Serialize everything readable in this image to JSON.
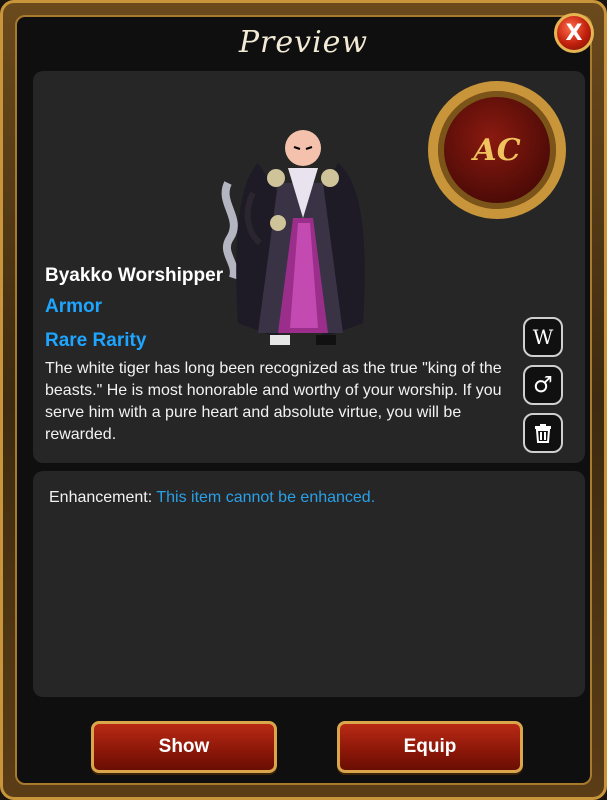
{
  "window": {
    "title": "Preview",
    "close_label": "X"
  },
  "item": {
    "name": "Byakko Worshipper",
    "type": "Armor",
    "rarity": "Rare Rarity",
    "description": "The white tiger has long been recognized as the true \"king of the beasts.\"  He is most honorable and worthy of your worship. If you serve him with a pure heart and absolute virtue, you will be rewarded."
  },
  "badge": {
    "text": "AC"
  },
  "side_buttons": {
    "w_label": "W",
    "gender_label": "♂",
    "trash_icon": "trash-icon"
  },
  "enhancement": {
    "label": "Enhancement:",
    "value": "This item cannot be enhanced."
  },
  "actions": {
    "show_label": "Show",
    "equip_label": "Equip"
  },
  "colors": {
    "frame_gold": "#c8953a",
    "panel": "#262626",
    "accent_blue": "#1ea5ff",
    "button_red": "#b82a14"
  }
}
